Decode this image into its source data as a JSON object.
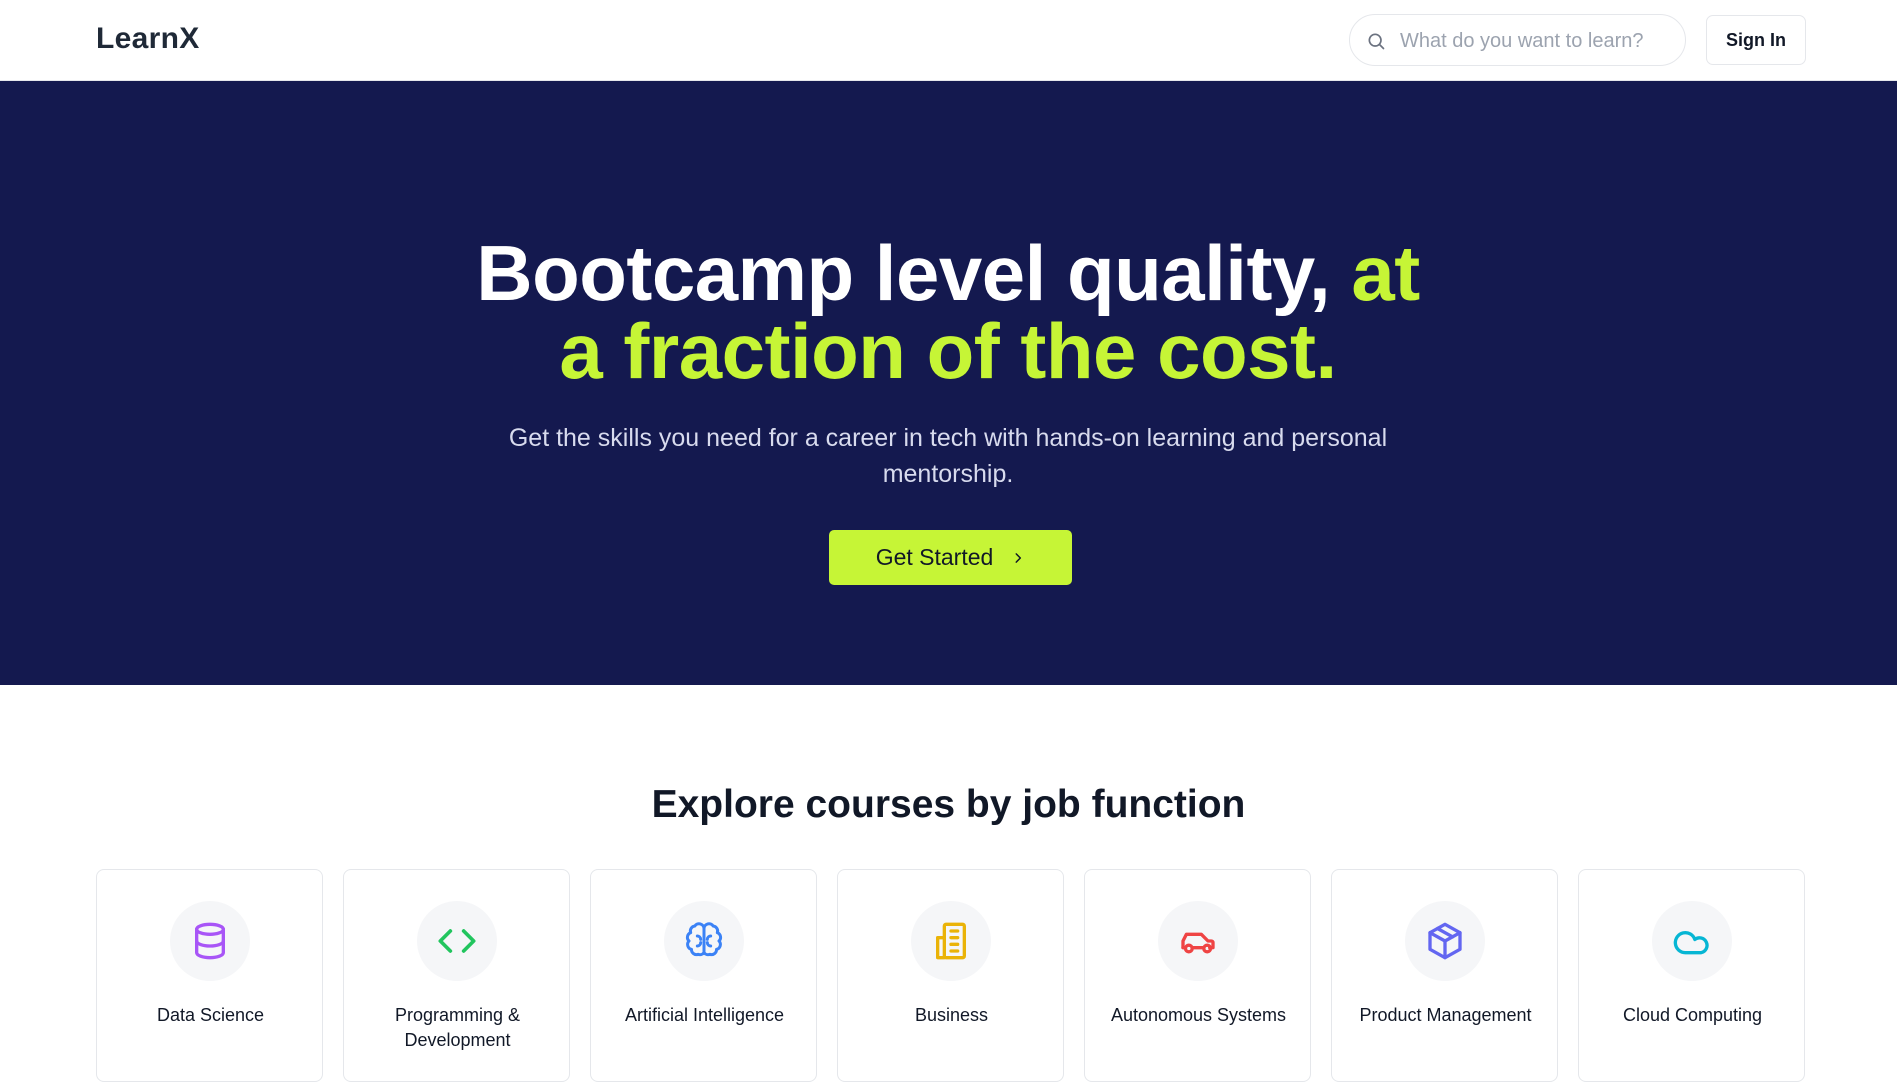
{
  "header": {
    "logo": "LearnX",
    "search_placeholder": "What do you want to learn?",
    "signin_label": "Sign In"
  },
  "hero": {
    "title_white": "Bootcamp level quality, ",
    "title_accent": "at a fraction of the cost.",
    "subtitle": "Get the skills you need for a career in tech with hands-on learning and personal mentorship.",
    "cta_label": "Get Started",
    "background_color": "#14194f",
    "accent_color": "#c6f536"
  },
  "explore": {
    "title": "Explore courses by job function",
    "categories": [
      {
        "label": "Data Science",
        "icon": "database-icon",
        "color": "#a855f7"
      },
      {
        "label": "Programming & Development",
        "icon": "code-icon",
        "color": "#22c55e"
      },
      {
        "label": "Artificial Intelligence",
        "icon": "brain-icon",
        "color": "#3b82f6"
      },
      {
        "label": "Business",
        "icon": "building-icon",
        "color": "#eab308"
      },
      {
        "label": "Autonomous Systems",
        "icon": "car-icon",
        "color": "#ef4444"
      },
      {
        "label": "Product Management",
        "icon": "box-icon",
        "color": "#6366f1"
      },
      {
        "label": "Cloud Computing",
        "icon": "cloud-icon",
        "color": "#06b6d4"
      }
    ]
  }
}
